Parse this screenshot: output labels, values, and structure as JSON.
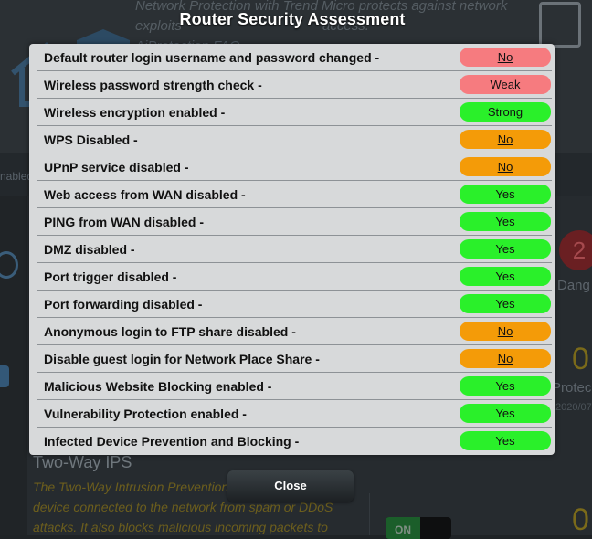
{
  "background": {
    "intro_text_line1": "Network Protection with Trend Micro protects against network",
    "intro_text_line2": "exploits",
    "intro_text_line2_tail": "access.",
    "faq_link": "AiProtection FAQ",
    "tab_fragment": "nabled",
    "danger_count": "2",
    "danger_label": "Dang",
    "protected_num": "0",
    "protected_label": "Protec",
    "date_fragment": "2020/07",
    "ips_title": "Two-Way IPS",
    "ips_desc_line1": "The Two-Way Intrusion Prevention",
    "ips_desc_line2": "device connected to the network from spam or DDoS",
    "ips_desc_line3": "attacks. It also blocks malicious incoming packets to",
    "bottom_num": "0",
    "toggle_on_label": "ON"
  },
  "dialog": {
    "title": "Router Security Assessment",
    "close_label": "Close",
    "items": [
      {
        "label": "Default router login username and password changed -",
        "status": "No",
        "kind": "fail",
        "link": true
      },
      {
        "label": "Wireless password strength check -",
        "status": "Weak",
        "kind": "fail",
        "link": false
      },
      {
        "label": "Wireless encryption enabled -",
        "status": "Strong",
        "kind": "pass",
        "link": false
      },
      {
        "label": "WPS Disabled -",
        "status": "No",
        "kind": "warn",
        "link": true
      },
      {
        "label": "UPnP service disabled -",
        "status": "No",
        "kind": "warn",
        "link": true
      },
      {
        "label": "Web access from WAN disabled -",
        "status": "Yes",
        "kind": "pass",
        "link": false
      },
      {
        "label": "PING from WAN disabled -",
        "status": "Yes",
        "kind": "pass",
        "link": false
      },
      {
        "label": "DMZ disabled -",
        "status": "Yes",
        "kind": "pass",
        "link": false
      },
      {
        "label": "Port trigger disabled -",
        "status": "Yes",
        "kind": "pass",
        "link": false
      },
      {
        "label": "Port forwarding disabled -",
        "status": "Yes",
        "kind": "pass",
        "link": false
      },
      {
        "label": "Anonymous login to FTP share disabled -",
        "status": "No",
        "kind": "warn",
        "link": true
      },
      {
        "label": "Disable guest login for Network Place Share -",
        "status": "No",
        "kind": "warn",
        "link": true
      },
      {
        "label": "Malicious Website Blocking enabled -",
        "status": "Yes",
        "kind": "pass",
        "link": false
      },
      {
        "label": "Vulnerability Protection enabled -",
        "status": "Yes",
        "kind": "pass",
        "link": false
      },
      {
        "label": "Infected Device Prevention and Blocking -",
        "status": "Yes",
        "kind": "pass",
        "link": false
      }
    ]
  },
  "colors": {
    "fail": "#f67b7f",
    "warn": "#f49b08",
    "pass": "#2af02a",
    "panel_bg": "#d7d9da"
  }
}
